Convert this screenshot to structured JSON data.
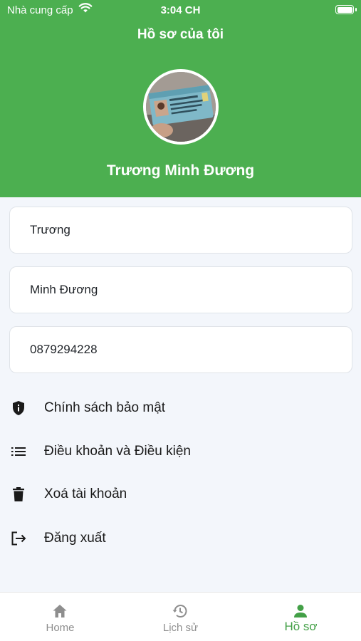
{
  "status_bar": {
    "carrier": "Nhà cung cấp",
    "time": "3:04 CH"
  },
  "header": {
    "title": "Hồ sơ của tôi",
    "full_name": "Trương Minh Đương"
  },
  "form": {
    "last_name": "Trương",
    "first_name": "Minh Đương",
    "phone": "0879294228"
  },
  "menu": {
    "privacy": {
      "label": "Chính sách bảo mật",
      "icon": "shield-icon"
    },
    "terms": {
      "label": "Điều khoản và Điều kiện",
      "icon": "list-icon"
    },
    "delete_account": {
      "label": "Xoá tài khoản",
      "icon": "trash-icon"
    },
    "logout": {
      "label": "Đăng xuất",
      "icon": "logout-icon"
    }
  },
  "tabs": {
    "home": {
      "label": "Home",
      "icon": "home-icon"
    },
    "history": {
      "label": "Lịch sử",
      "icon": "history-icon"
    },
    "profile": {
      "label": "Hồ sơ",
      "icon": "person-icon",
      "active": true
    }
  },
  "colors": {
    "primary": "#4caf50",
    "active_tab": "#43a047",
    "background": "#f3f6fb"
  }
}
